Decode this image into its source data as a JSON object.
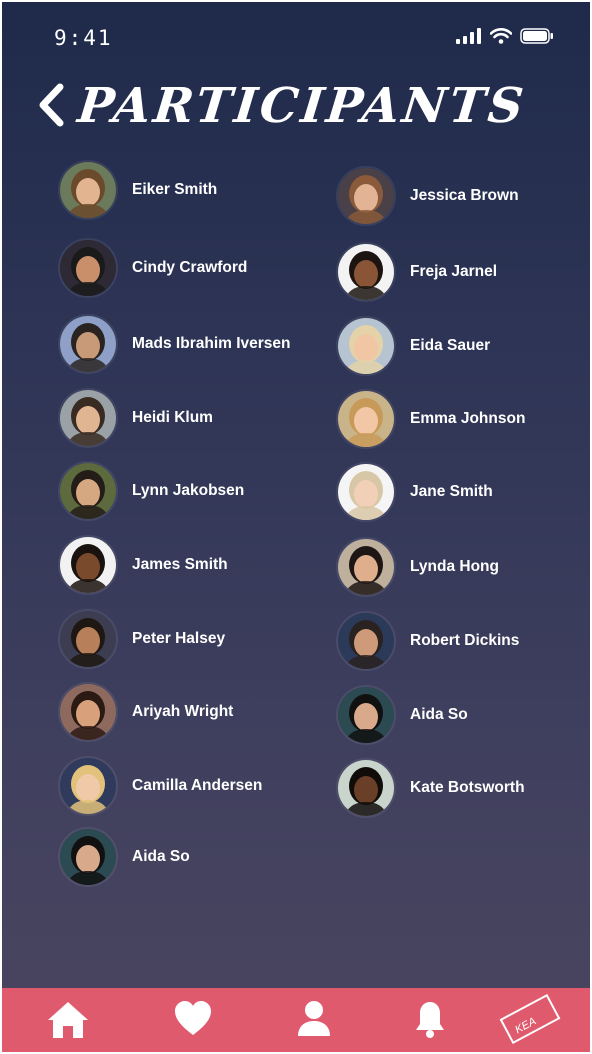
{
  "status_bar": {
    "time": "9:41"
  },
  "header": {
    "title": "PARTICIPANTS"
  },
  "participants": {
    "left": [
      {
        "name": "Eiker Smith",
        "bg": "#6b7a5a",
        "skin": "#e2b48f",
        "hair": "#6b4a2b"
      },
      {
        "name": "Cindy Crawford",
        "bg": "#2e2a35",
        "skin": "#c98f6a",
        "hair": "#1a1a1a"
      },
      {
        "name": "Mads Ibrahim Iversen",
        "bg": "#8ea0c8",
        "skin": "#c89a78",
        "hair": "#2a2420"
      },
      {
        "name": "Heidi Klum",
        "bg": "#9aa2a8",
        "skin": "#e0b592",
        "hair": "#3a2b22"
      },
      {
        "name": "Lynn Jakobsen",
        "bg": "#5c6a3e",
        "skin": "#d6a882",
        "hair": "#241c18"
      },
      {
        "name": "James Smith",
        "bg": "#f2f2f2",
        "skin": "#7a4a2c",
        "hair": "#1a120e"
      },
      {
        "name": "Peter Halsey",
        "bg": "#3d3d52",
        "skin": "#b7805a",
        "hair": "#1e1712"
      },
      {
        "name": "Ariyah Wright",
        "bg": "#8e6a5e",
        "skin": "#d9a07c",
        "hair": "#2b1a14"
      },
      {
        "name": "Camilla Andersen",
        "bg": "#2f3a5c",
        "skin": "#efc9a8",
        "hair": "#e2c27a"
      },
      {
        "name": "Aida So",
        "bg": "#2b4a52",
        "skin": "#d8a98a",
        "hair": "#111111"
      }
    ],
    "right": [
      {
        "name": "Jessica Brown",
        "bg": "#4a4048",
        "skin": "#e2b394",
        "hair": "#8a5a3a"
      },
      {
        "name": "Freja Jarnel",
        "bg": "#f3f3f3",
        "skin": "#8a5536",
        "hair": "#1b1410"
      },
      {
        "name": "Eida Sauer",
        "bg": "#b6c4d2",
        "skin": "#f0c6a4",
        "hair": "#e4d2a8"
      },
      {
        "name": "Emma Johnson",
        "bg": "#c9b489",
        "skin": "#f1c7a6",
        "hair": "#c89a5a"
      },
      {
        "name": "Jane Smith",
        "bg": "#f5f5f5",
        "skin": "#f2d0b7",
        "hair": "#d8c7a6"
      },
      {
        "name": "Lynda Hong",
        "bg": "#bfb09e",
        "skin": "#dfae8c",
        "hair": "#1d1614"
      },
      {
        "name": "Robert Dickins",
        "bg": "#2c3a5a",
        "skin": "#cf9a7a",
        "hair": "#2a2220"
      },
      {
        "name": "Aida So",
        "bg": "#2b4a52",
        "skin": "#d8a98a",
        "hair": "#111111"
      },
      {
        "name": "Kate Botsworth",
        "bg": "#c8d4cc",
        "skin": "#6a3f28",
        "hair": "#0f0c0a"
      }
    ]
  },
  "tab_bar": {
    "items": [
      "home-icon",
      "heart-icon",
      "profile-icon",
      "bell-icon",
      "kea-ticket-icon"
    ],
    "ticket_text": "KEA",
    "color": "#e05a6d"
  },
  "colors": {
    "accent": "#e05a6d",
    "bg_top": "#1f2a4a",
    "bg_bottom": "#4b4660"
  }
}
